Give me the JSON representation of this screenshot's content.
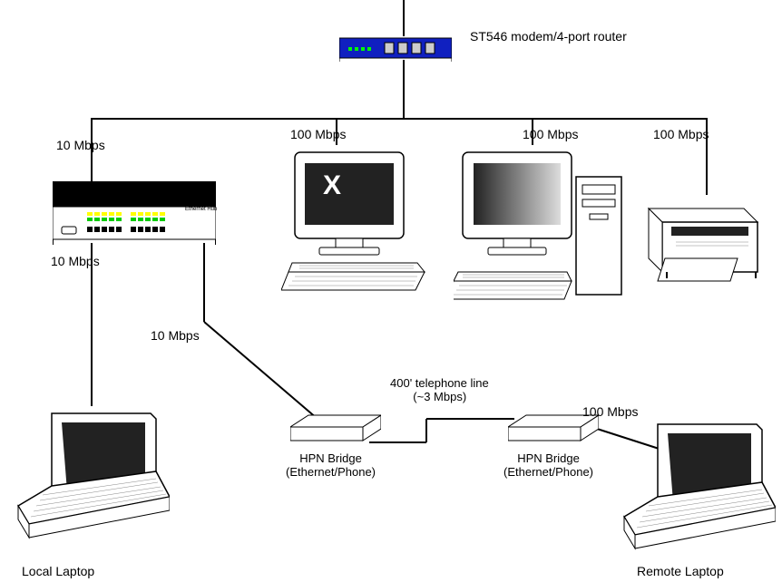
{
  "router_label": "ST546 modem/4-port router",
  "speeds": {
    "hub_from_router": "10 Mbps",
    "pc1": "100 Mbps",
    "pc2": "100 Mbps",
    "printer": "100 Mbps",
    "hub_to_laptop": "10 Mbps",
    "hub_to_bridge": "10 Mbps",
    "bridge_to_remote": "100 Mbps"
  },
  "telephone_line": "400' telephone line\n       (~3 Mbps)",
  "bridge_label_1": "HPN Bridge\n(Ethernet/Phone)",
  "bridge_label_2": "HPN Bridge\n(Ethernet/Phone)",
  "local_laptop_label": "Local Laptop",
  "remote_laptop_label": "Remote Laptop",
  "hub_label": "Ethernet\nHub",
  "monitor_x": "X"
}
